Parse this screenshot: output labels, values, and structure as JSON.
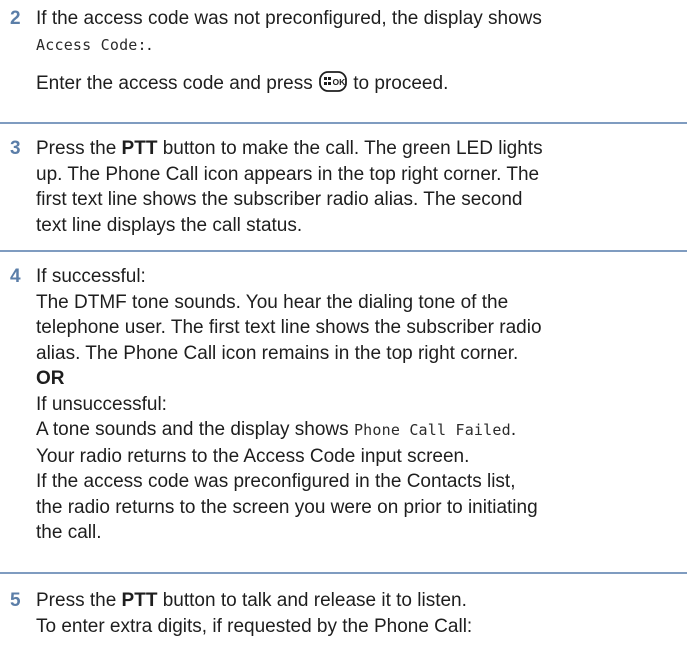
{
  "steps": [
    {
      "number": "2",
      "p1_text": "If the access code was not preconfigured, the display shows",
      "p1_code": "Access Code:",
      "p1_end": ".",
      "p2_before": "Enter the access code and press",
      "p2_after": "to proceed.",
      "ok_icon": "menu-ok-key-icon",
      "ok_icon_text": "OK"
    },
    {
      "number": "3",
      "l1_a": "Press the",
      "l1_b": "PTT",
      "l1_c": "button to make the call. The green LED lights",
      "l2": "up. The Phone Call icon appears in the top right corner. The",
      "l3": "first text line shows the subscriber radio alias. The second",
      "l4": "text line displays the call status."
    },
    {
      "number": "4",
      "l1": "If successful:",
      "l2": "The DTMF tone sounds. You hear the dialing tone of the",
      "l3": "telephone user. The first text line shows the subscriber radio",
      "l4": "alias. The Phone Call icon remains in the top right corner.",
      "or": "OR",
      "l5": "If unsuccessful:",
      "l6_a": "A tone sounds and the display shows",
      "l6_code": "Phone Call Failed",
      "l6_end": ".",
      "l7": "Your radio returns to the Access Code input screen.",
      "l8": "If the access code was preconfigured in the Contacts list,",
      "l9": "the radio returns to the screen you were on prior to initiating",
      "l10": "the call."
    },
    {
      "number": "5",
      "l1_a": "Press the",
      "l1_b": "PTT",
      "l1_c": "button to talk and release it to listen.",
      "l2": "To enter extra digits, if requested by the Phone Call:"
    }
  ],
  "colors": {
    "step_number": "#5b7ea8",
    "rule": "#7f9cc0",
    "text": "#1e1e1e"
  }
}
